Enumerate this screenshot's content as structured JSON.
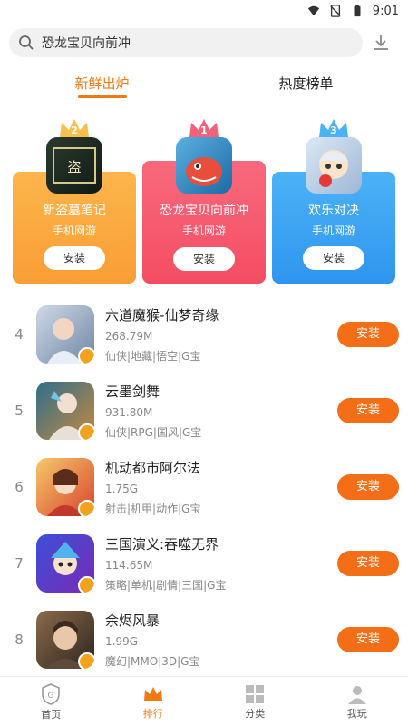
{
  "status": {
    "time": "9:01"
  },
  "search": {
    "text": "恐龙宝贝向前冲"
  },
  "tabs": [
    {
      "label": "新鲜出炉"
    },
    {
      "label": "热度榜单"
    }
  ],
  "podium": [
    {
      "rank": "2",
      "name": "新盗墓笔记",
      "category": "手机网游",
      "button": "安装",
      "color": "#fca43a"
    },
    {
      "rank": "1",
      "name": "恐龙宝贝向前冲",
      "category": "手机网游",
      "button": "安装",
      "color": "#f6556c"
    },
    {
      "rank": "3",
      "name": "欢乐对决",
      "category": "手机网游",
      "button": "安装",
      "color": "#3ea3f5"
    }
  ],
  "list": [
    {
      "rank": "4",
      "name": "六道魔猴-仙梦奇缘",
      "size": "268.79M",
      "tags": "仙侠|地藏|悟空|G宝",
      "button": "安装"
    },
    {
      "rank": "5",
      "name": "云墨剑舞",
      "size": "931.80M",
      "tags": "仙侠|RPG|国风|G宝",
      "button": "安装"
    },
    {
      "rank": "6",
      "name": "机动都市阿尔法",
      "size": "1.75G",
      "tags": "射击|机甲|动作|G宝",
      "button": "安装"
    },
    {
      "rank": "7",
      "name": "三国演义:吞噬无界",
      "size": "114.65M",
      "tags": "策略|单机|剧情|三国|G宝",
      "button": "安装"
    },
    {
      "rank": "8",
      "name": "余烬风暴",
      "size": "1.99G",
      "tags": "魔幻|MMO|3D|G宝",
      "button": "安装"
    }
  ],
  "nav": [
    {
      "label": "首页"
    },
    {
      "label": "排行"
    },
    {
      "label": "分类"
    },
    {
      "label": "我玩"
    }
  ],
  "colors": {
    "accent": "#f07a14",
    "install": "#f36e16"
  }
}
